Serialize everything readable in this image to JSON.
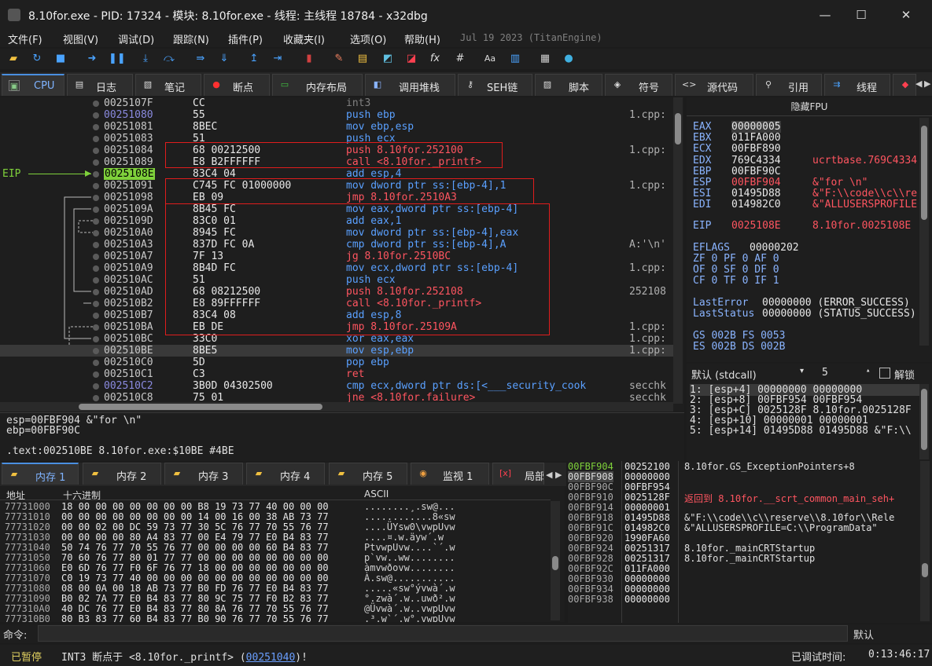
{
  "window": {
    "title": "8.10for.exe - PID: 17324 - 模块: 8.10for.exe - 线程: 主线程 18784 - x32dbg",
    "minimize": "—",
    "maximize": "☐",
    "close": "✕"
  },
  "menu": [
    "文件(F)",
    "视图(V)",
    "调试(D)",
    "跟踪(N)",
    "插件(P)",
    "收藏夹(I)",
    "选项(O)",
    "帮助(H)"
  ],
  "menu_version": "Jul 19 2023 (TitanEngine)",
  "toolbar": [
    "open-icon",
    "restart-icon",
    "stop-icon",
    "run-icon",
    "pause-icon",
    "step-into-icon",
    "step-over-icon",
    "trace-into-icon",
    "trace-over-icon",
    "execute-till-return-icon",
    "run-to-user-code-icon",
    "scylla-icon",
    "highlight-icon",
    "comment-icon",
    "label-icon",
    "bookmark-icon",
    "function-icon",
    "hash-icon",
    "font-icon",
    "strings-icon",
    "calculator-icon",
    "globe-icon"
  ],
  "tabs": [
    {
      "label": "CPU",
      "icon": "cpu-icon"
    },
    {
      "label": "日志",
      "icon": "log-icon"
    },
    {
      "label": "笔记",
      "icon": "notes-icon"
    },
    {
      "label": "断点",
      "icon": "breakpoint-icon"
    },
    {
      "label": "内存布局",
      "icon": "memory-map-icon"
    },
    {
      "label": "调用堆栈",
      "icon": "callstack-icon"
    },
    {
      "label": "SEH链",
      "icon": "seh-icon"
    },
    {
      "label": "脚本",
      "icon": "script-icon"
    },
    {
      "label": "符号",
      "icon": "symbols-icon"
    },
    {
      "label": "源代码",
      "icon": "source-icon"
    },
    {
      "label": "引用",
      "icon": "references-icon"
    },
    {
      "label": "线程",
      "icon": "threads-icon"
    },
    {
      "label": "",
      "icon": "handles-icon"
    }
  ],
  "eip_label": "EIP",
  "disasm": [
    {
      "addr": "0025107F",
      "hex": "CC",
      "asm": [
        [
          "int3",
          "g"
        ]
      ],
      "cmt": ""
    },
    {
      "addr": "00251080",
      "hex": "55",
      "asm": [
        [
          "push ebp",
          "b"
        ]
      ],
      "cmt": "1.cpp:",
      "lbl": true
    },
    {
      "addr": "00251081",
      "hex": "8BEC",
      "asm": [
        [
          "mov ebp,esp",
          "b"
        ]
      ],
      "cmt": ""
    },
    {
      "addr": "00251083",
      "hex": "51",
      "asm": [
        [
          "push ecx",
          "b"
        ]
      ],
      "cmt": ""
    },
    {
      "addr": "00251084",
      "hex": "68 00212500",
      "asm": [
        [
          "push 8.10for.252100",
          "r"
        ]
      ],
      "cmt": "1.cpp:"
    },
    {
      "addr": "00251089",
      "hex": "E8 B2FFFFFF",
      "asm": [
        [
          "call <8.10for._printf>",
          "r"
        ]
      ],
      "cmt": ""
    },
    {
      "addr": "0025108E",
      "hex": "83C4 04",
      "asm": [
        [
          "add esp,4",
          "b"
        ]
      ],
      "cmt": "",
      "eip": true
    },
    {
      "addr": "00251091",
      "hex": "C745 FC 01000000",
      "asm": [
        [
          "mov dword ptr ss:[ebp-4],1",
          "b"
        ]
      ],
      "cmt": "1.cpp:"
    },
    {
      "addr": "00251098",
      "hex": "EB 09",
      "asm": [
        [
          "jmp 8.10for.2510A3",
          "r"
        ]
      ],
      "cmt": ""
    },
    {
      "addr": "0025109A",
      "hex": "8B45 FC",
      "asm": [
        [
          "mov eax,dword ptr ss:[ebp-4]",
          "b"
        ]
      ],
      "cmt": ""
    },
    {
      "addr": "0025109D",
      "hex": "83C0 01",
      "asm": [
        [
          "add eax,1",
          "b"
        ]
      ],
      "cmt": ""
    },
    {
      "addr": "002510A0",
      "hex": "8945 FC",
      "asm": [
        [
          "mov dword ptr ss:[ebp-4],eax",
          "b"
        ]
      ],
      "cmt": ""
    },
    {
      "addr": "002510A3",
      "hex": "837D FC 0A",
      "asm": [
        [
          "cmp dword ptr ss:[ebp-4],A",
          "b"
        ]
      ],
      "cmt": "A:'\\n'"
    },
    {
      "addr": "002510A7",
      "hex": "7F 13",
      "asm": [
        [
          "jg 8.10for.2510BC",
          "r"
        ]
      ],
      "cmt": ""
    },
    {
      "addr": "002510A9",
      "hex": "8B4D FC",
      "asm": [
        [
          "mov ecx,dword ptr ss:[ebp-4]",
          "b"
        ]
      ],
      "cmt": "1.cpp:"
    },
    {
      "addr": "002510AC",
      "hex": "51",
      "asm": [
        [
          "push ecx",
          "b"
        ]
      ],
      "cmt": ""
    },
    {
      "addr": "002510AD",
      "hex": "68 08212500",
      "asm": [
        [
          "push 8.10for.252108",
          "r"
        ]
      ],
      "cmt": "252108"
    },
    {
      "addr": "002510B2",
      "hex": "E8 89FFFFFF",
      "asm": [
        [
          "call <8.10for._printf>",
          "r"
        ]
      ],
      "cmt": ""
    },
    {
      "addr": "002510B7",
      "hex": "83C4 08",
      "asm": [
        [
          "add esp,8",
          "b"
        ]
      ],
      "cmt": ""
    },
    {
      "addr": "002510BA",
      "hex": "EB DE",
      "asm": [
        [
          "jmp 8.10for.25109A",
          "r"
        ]
      ],
      "cmt": "1.cpp:"
    },
    {
      "addr": "002510BC",
      "hex": "33C0",
      "asm": [
        [
          "xor eax,eax",
          "b"
        ]
      ],
      "cmt": "1.cpp:"
    },
    {
      "addr": "002510BE",
      "hex": "8BE5",
      "asm": [
        [
          "mov esp,ebp",
          "b"
        ]
      ],
      "cmt": "1.cpp:",
      "sel": true
    },
    {
      "addr": "002510C0",
      "hex": "5D",
      "asm": [
        [
          "pop ebp",
          "b"
        ]
      ],
      "cmt": ""
    },
    {
      "addr": "002510C1",
      "hex": "C3",
      "asm": [
        [
          "ret",
          "r"
        ]
      ],
      "cmt": ""
    },
    {
      "addr": "002510C2",
      "hex": "3B0D 04302500",
      "asm": [
        [
          "cmp ecx,dword ptr ds:[<___security_cook",
          "b"
        ]
      ],
      "cmt": "secchk",
      "lbl": true
    },
    {
      "addr": "002510C8",
      "hex": "75 01",
      "asm": [
        [
          "jne <8.10for.failure>",
          "r"
        ]
      ],
      "cmt": "secchk"
    }
  ],
  "info": [
    "esp=00FBF904 &\"for \\n\"",
    "ebp=00FBF90C",
    ".text:002510BE 8.10for.exe:$10BE #4BE"
  ],
  "regs": {
    "header": "隐藏FPU",
    "gp": [
      [
        "EAX",
        "00000005",
        ""
      ],
      [
        "EBX",
        "011FA000",
        ""
      ],
      [
        "ECX",
        "00FBF890",
        ""
      ],
      [
        "EDX",
        "769C4334",
        "ucrtbase.769C4334"
      ],
      [
        "EBP",
        "00FBF90C",
        ""
      ],
      [
        "ESP",
        "00FBF904",
        "&\"for \\n\""
      ],
      [
        "ESI",
        "01495D88",
        "&\"F:\\\\code\\\\c\\\\re"
      ],
      [
        "EDI",
        "014982C0",
        "&\"ALLUSERSPROFILE"
      ]
    ],
    "eip": [
      "EIP",
      "0025108E",
      "8.10for.0025108E"
    ],
    "eflags": [
      "EFLAGS",
      "00000202"
    ],
    "flags": [
      "ZF 0  PF 0  AF 0",
      "OF 0  SF 0  DF 0",
      "CF 0  TF 0  IF 1"
    ],
    "last": [
      [
        "LastError",
        "00000000 (ERROR_SUCCESS)"
      ],
      [
        "LastStatus",
        "00000000 (STATUS_SUCCESS)"
      ]
    ],
    "seg": [
      "GS 002B  FS 0053",
      "ES 002B  DS 002B"
    ]
  },
  "callconv": {
    "convention": "默认 (stdcall)",
    "count": "5",
    "unlock": "解锁"
  },
  "args": [
    "1: [esp+4]  00000000 00000000",
    "2: [esp+8]  00FBF954 00FBF954",
    "3: [esp+C]  0025128F 8.10for.0025128F",
    "4: [esp+10] 00000001 00000001",
    "5: [esp+14] 01495D88 01495D88 &\"F:\\\\"
  ],
  "dumptabs": [
    "内存 1",
    "内存 2",
    "内存 3",
    "内存 4",
    "内存 5",
    "监视 1",
    "局部"
  ],
  "dump": {
    "h_addr": "地址",
    "h_hex": "十六进制",
    "h_ascii": "ASCII",
    "rows": [
      [
        "77731000",
        "18 00 00 00 00 00 00 00 B8 19 73 77 40 00 00 00",
        "........¸.sw@..."
      ],
      [
        "77731010",
        "00 00 00 00 00 00 00 00 14 00 16 00 38 AB 73 77",
        "............8«sw"
      ],
      [
        "77731020",
        "00 00 02 00 DC 59 73 77 30 5C 76 77 70 55 76 77",
        "....ÜYsw0\\vwpUvw"
      ],
      [
        "77731030",
        "00 00 00 00 80 A4 83 77 00 E4 79 77 E0 B4 83 77",
        "....¤.w.äyw´.w"
      ],
      [
        "77731040",
        "50 74 76 77 70 55 76 77 00 00 00 00 60 B4 83 77",
        "PtvwpUvw....`´.w"
      ],
      [
        "77731050",
        "70 60 76 77 80 01 77 77 00 00 00 00 00 00 00 00",
        "p`vw..ww........"
      ],
      [
        "77731060",
        "E0 6D 76 77 F0 6F 76 77 18 00 00 00 00 00 00 00",
        "àmvwðovw........"
      ],
      [
        "77731070",
        "C0 19 73 77 40 00 00 00 00 00 00 00 00 00 00 00",
        "À.sw@..........."
      ],
      [
        "77731080",
        "08 00 0A 00 18 AB 73 77 B0 FD 76 77 E0 B4 83 77",
        ".....«sw°ývwà´.w"
      ],
      [
        "77731090",
        "B0 02 7A 77 E0 B4 83 77 80 9C 75 77 F0 B2 83 77",
        "°.zwà´.w..uwð².w"
      ],
      [
        "777310A0",
        "40 DC 76 77 E0 B4 83 77 80 8A 76 77 70 55 76 77",
        "@Üvwà´.w..vwpUvw"
      ],
      [
        "777310B0",
        "80 B3 83 77 60 B4 83 77 B0 90 76 77 70 55 76 77",
        ".³.w`´.w°.vwpUvw"
      ]
    ]
  },
  "stack": [
    [
      "00FBF904",
      "00252100",
      "8.10for.GS_ExceptionPointers+8"
    ],
    [
      "00FBF908",
      "00000000",
      ""
    ],
    [
      "00FBF90C",
      "00FBF954",
      ""
    ],
    [
      "00FBF910",
      "0025128F",
      "返回到 8.10for.__scrt_common_main_seh+"
    ],
    [
      "00FBF914",
      "00000001",
      ""
    ],
    [
      "00FBF918",
      "01495D88",
      "&\"F:\\\\code\\\\c\\\\reserve\\\\8.10for\\\\Rele"
    ],
    [
      "00FBF91C",
      "014982C0",
      "&\"ALLUSERSPROFILE=C:\\\\ProgramData\""
    ],
    [
      "00FBF920",
      "1990FA60",
      ""
    ],
    [
      "00FBF924",
      "00251317",
      "8.10for._mainCRTStartup"
    ],
    [
      "00FBF928",
      "00251317",
      "8.10for._mainCRTStartup"
    ],
    [
      "00FBF92C",
      "011FA000",
      ""
    ],
    [
      "00FBF930",
      "00000000",
      ""
    ],
    [
      "00FBF934",
      "00000000",
      ""
    ],
    [
      "00FBF938",
      "00000000",
      ""
    ]
  ],
  "command": {
    "label": "命令:",
    "value": "",
    "mode": "默认"
  },
  "status": {
    "state": "已暂停",
    "msg_a": "INT3  断点于 <8.10for._printf> (",
    "msg_link": "00251040",
    "msg_b": ")!",
    "time_label": "已调试时间:",
    "time": "0:13:46:17"
  },
  "colors": {
    "accent": "#7fd13b",
    "red": "#e01d1d",
    "blue": "#5aa0ff",
    "redtext": "#ff5560"
  }
}
